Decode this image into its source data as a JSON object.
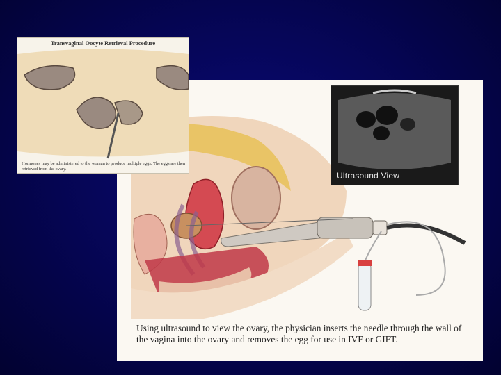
{
  "inset": {
    "title": "Transvaginal Oocyte Retrieval Procedure",
    "caption": "Hormones may be administered to the woman to produce multiple eggs. The eggs are then retrieved from the ovary."
  },
  "ultrasound": {
    "label": "Ultrasound View"
  },
  "main": {
    "caption": "Using ultrasound to view the ovary, the physician inserts the needle through the wall of the vagina into the ovary and removes the egg for use in IVF or GIFT."
  },
  "colors": {
    "background": "#05055a",
    "tissue_red": "#c8404a",
    "tissue_pink": "#e8a090",
    "fat_yellow": "#e8c868",
    "skin": "#f0d8c0"
  }
}
